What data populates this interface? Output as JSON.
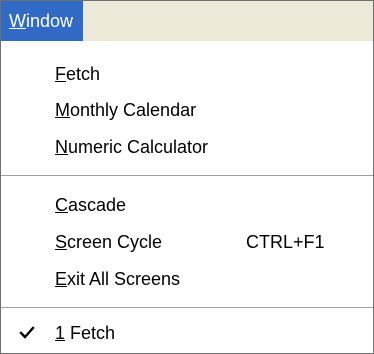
{
  "menu": {
    "title": "Window",
    "title_accel": "W",
    "title_rest": "indow"
  },
  "groups": [
    {
      "items": [
        {
          "accel": "F",
          "rest": "etch",
          "shortcut": ""
        },
        {
          "accel": "M",
          "rest": "onthly Calendar",
          "shortcut": ""
        },
        {
          "accel": "N",
          "rest": "umeric Calculator",
          "shortcut": ""
        }
      ]
    },
    {
      "items": [
        {
          "accel": "C",
          "rest": "ascade",
          "shortcut": ""
        },
        {
          "accel": "S",
          "rest": "creen Cycle",
          "shortcut": "CTRL+F1"
        },
        {
          "accel": "E",
          "rest": "xit All Screens",
          "shortcut": ""
        }
      ]
    },
    {
      "items": [
        {
          "accel": "1",
          "rest": " Fetch",
          "shortcut": "",
          "checked": true,
          "check_icon": "checkmark-icon"
        }
      ]
    }
  ],
  "colors": {
    "highlight": "#316ac5",
    "menubar_bg": "#ece9d8",
    "separator": "#a0a0a0"
  }
}
